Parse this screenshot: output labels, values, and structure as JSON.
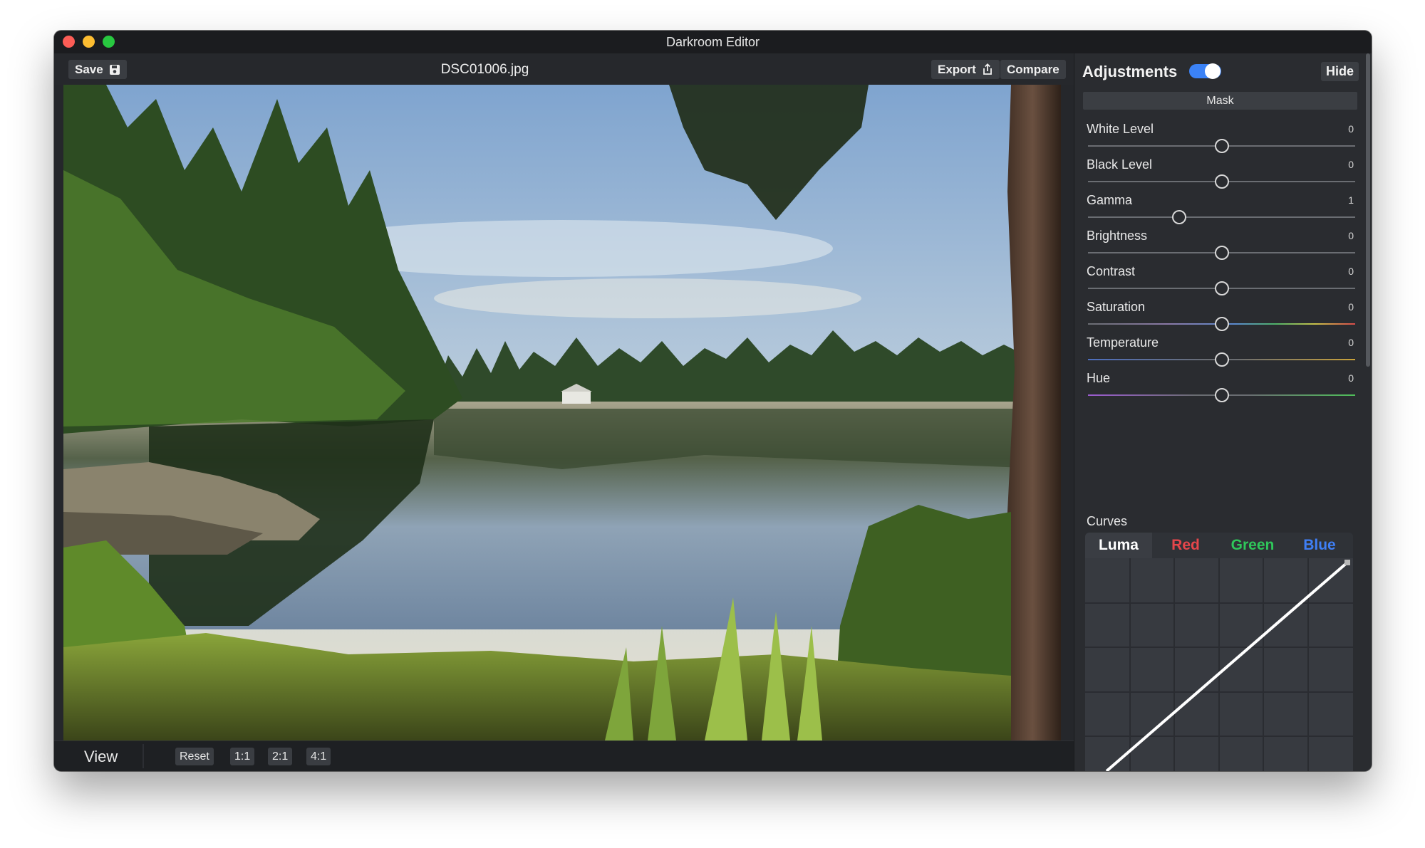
{
  "window": {
    "title": "Darkroom Editor"
  },
  "toolbar": {
    "save_label": "Save",
    "filename": "DSC01006.jpg",
    "export_label": "Export",
    "compare_label": "Compare"
  },
  "statusbar": {
    "view_label": "View",
    "buttons": [
      "Reset",
      "1:1",
      "2:1",
      "4:1"
    ]
  },
  "panel": {
    "title": "Adjustments",
    "toggle_on": true,
    "hide_label": "Hide",
    "mask_label": "Mask",
    "adjustments": [
      {
        "label": "White Level",
        "value": "0",
        "position": 0.5
      },
      {
        "label": "Black Level",
        "value": "0",
        "position": 0.5
      },
      {
        "label": "Gamma",
        "value": "1",
        "position": 0.34
      },
      {
        "label": "Brightness",
        "value": "0",
        "position": 0.5
      },
      {
        "label": "Contrast",
        "value": "0",
        "position": 0.5
      },
      {
        "label": "Saturation",
        "value": "0",
        "position": 0.5
      },
      {
        "label": "Temperature",
        "value": "0",
        "position": 0.5
      },
      {
        "label": "Hue",
        "value": "0",
        "position": 0.5
      }
    ],
    "curves_label": "Curves",
    "curve_tabs": [
      {
        "label": "Luma",
        "color": "#ffffff",
        "active": true
      },
      {
        "label": "Red",
        "color": "#e5464b",
        "active": false
      },
      {
        "label": "Green",
        "color": "#2fc65a",
        "active": false
      },
      {
        "label": "Blue",
        "color": "#3f7ff6",
        "active": false
      }
    ]
  },
  "colors": {
    "accent": "#3b82f6",
    "panel_bg": "#2a2c30",
    "button_bg": "#3a3d42"
  }
}
